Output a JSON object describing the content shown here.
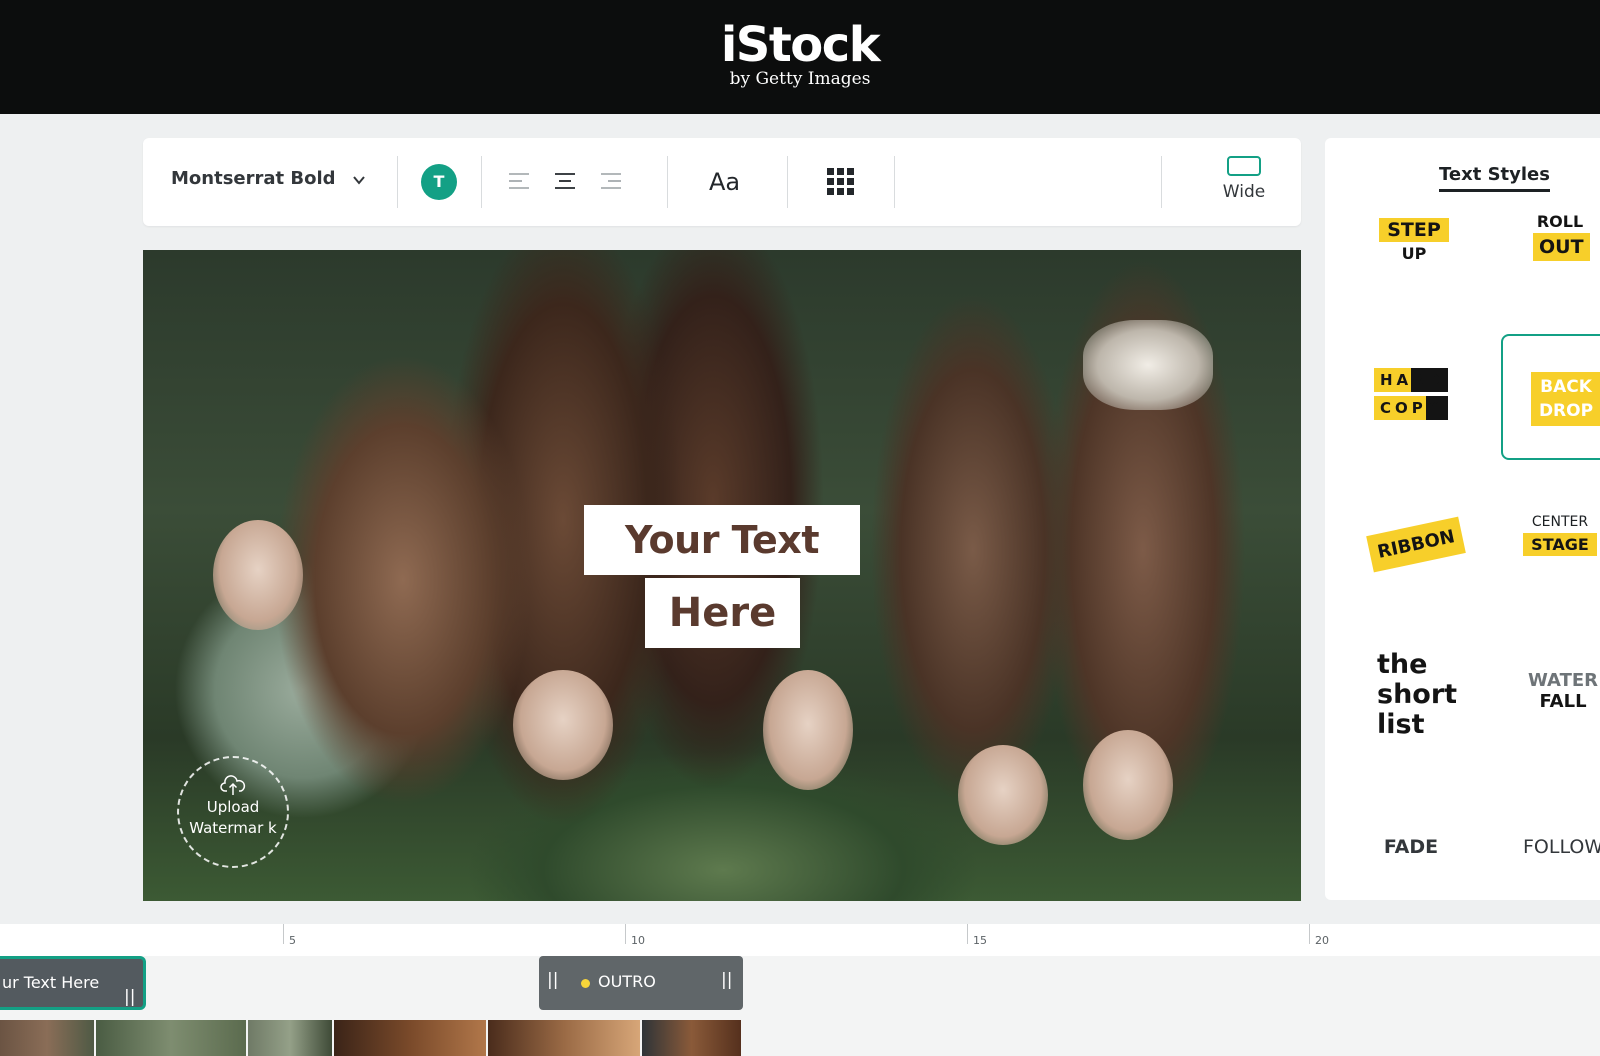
{
  "header": {
    "logo_main": "iStock",
    "logo_sub": "by Getty Images"
  },
  "toolbar": {
    "font_name": "Montserrat Bold",
    "color_letter": "T",
    "color_hex": "#13a085",
    "case_label": "Aa",
    "aspect_label": "Wide",
    "icons": [
      "chevron-down-icon",
      "align-left-icon",
      "align-center-icon",
      "align-right-icon",
      "grid-icon",
      "wide-aspect-icon"
    ]
  },
  "preview": {
    "text_line1": "Your Text",
    "text_line2": "Here",
    "watermark_line1": "Upload",
    "watermark_line2": "Watermar k"
  },
  "styles_panel": {
    "title": "Text Styles",
    "styles": [
      {
        "name": "step-up",
        "lines": [
          "STEP",
          "UP"
        ]
      },
      {
        "name": "roll-out",
        "lines": [
          "ROLL",
          "OUT"
        ]
      },
      {
        "name": "hard-copy",
        "lines": [
          "HARD",
          "COPY"
        ]
      },
      {
        "name": "back-drop",
        "lines": [
          "BACK",
          "DROP"
        ],
        "selected": true
      },
      {
        "name": "ribbon",
        "lines": [
          "RIBBON"
        ]
      },
      {
        "name": "center-stage",
        "lines": [
          "CENTER",
          "STAGE"
        ]
      },
      {
        "name": "the-short-list",
        "lines": [
          "the",
          "short",
          "list"
        ]
      },
      {
        "name": "water-fall",
        "lines": [
          "WATER",
          "FALL"
        ]
      },
      {
        "name": "fade",
        "lines": [
          "FADE"
        ]
      },
      {
        "name": "follow",
        "lines": [
          "FOLLOW"
        ]
      }
    ]
  },
  "timeline": {
    "ticks": [
      "5",
      "10",
      "15",
      "20"
    ],
    "text_clip_label": "ur Text Here",
    "outro_label": "OUTRO",
    "accent": "#13a085",
    "outro_dot_color": "#f7d53a"
  }
}
